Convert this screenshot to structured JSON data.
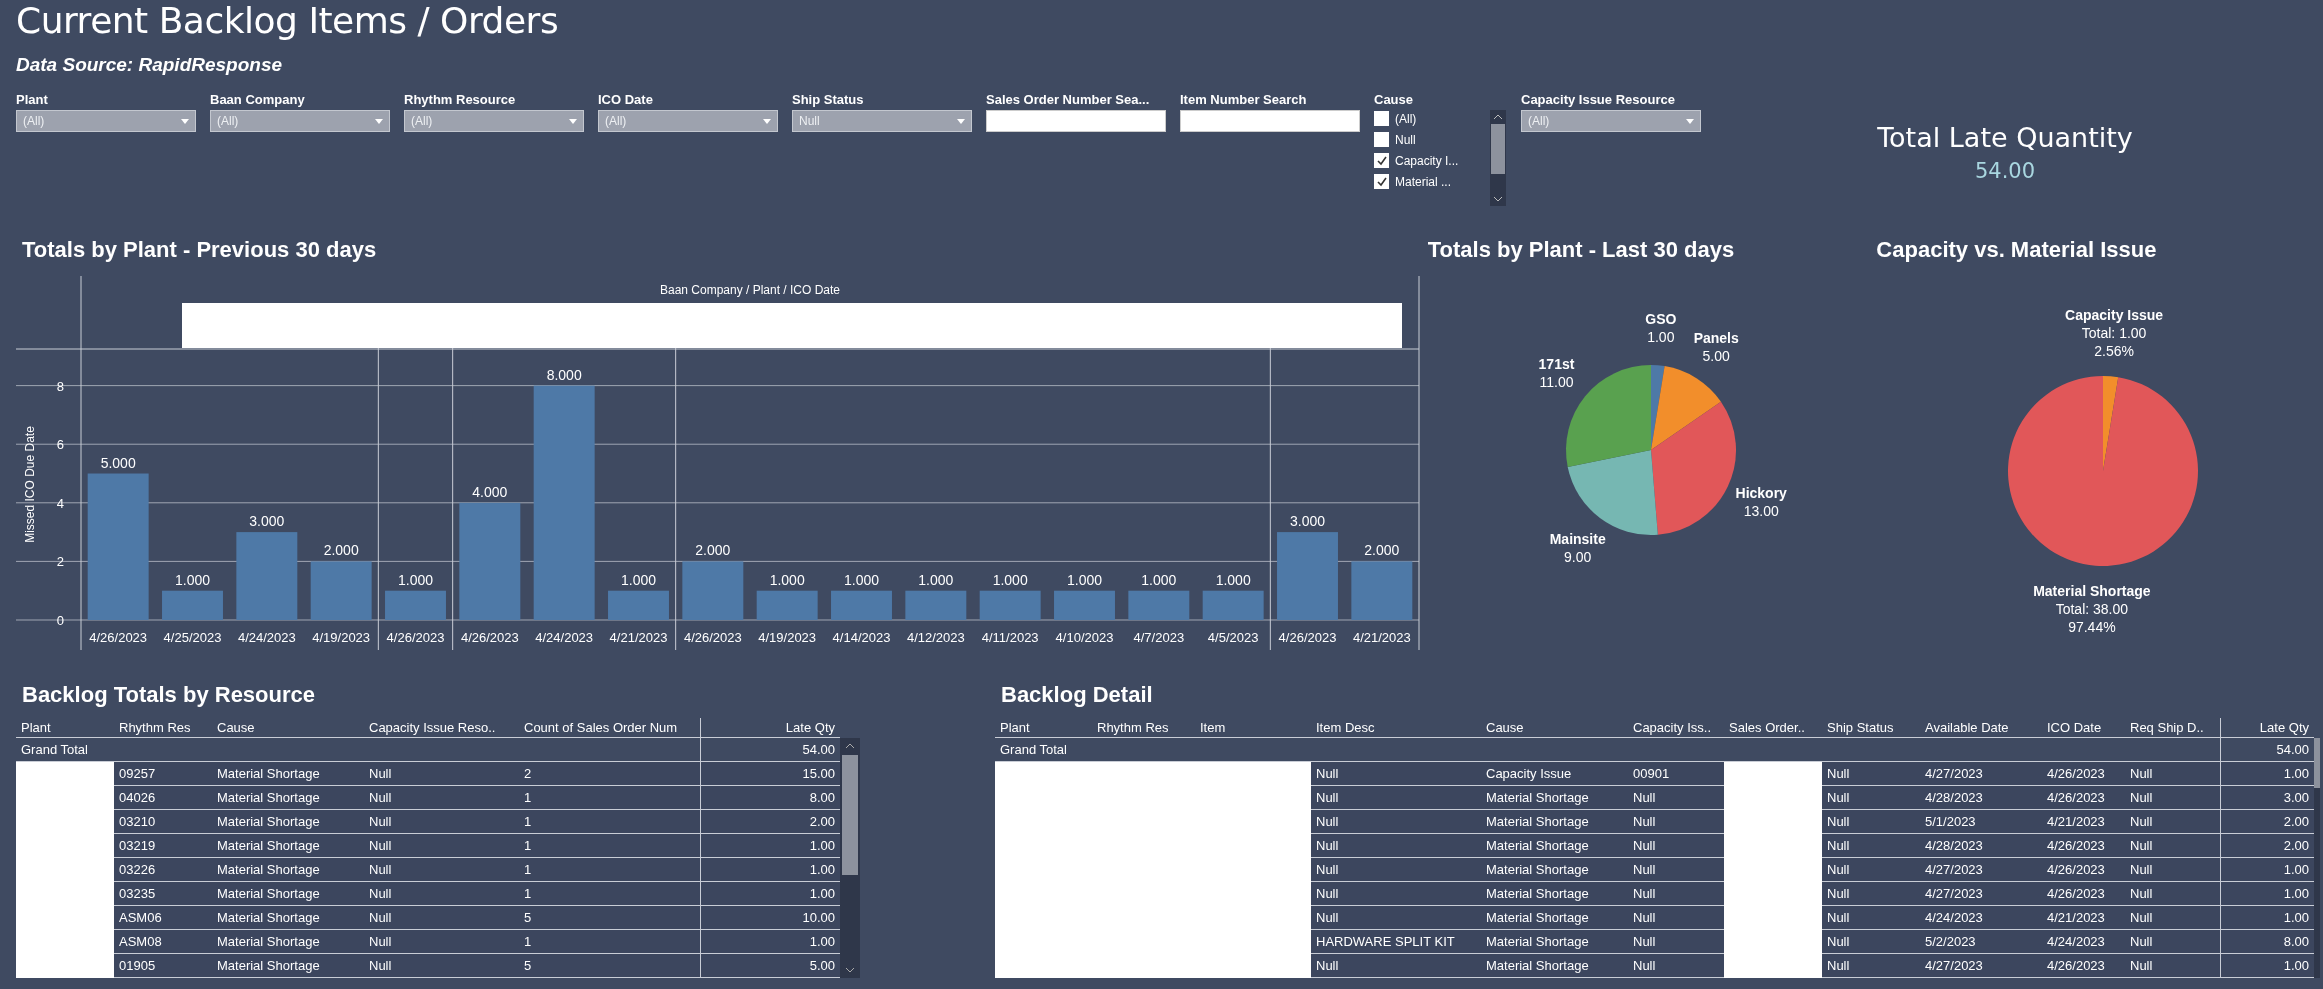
{
  "title": "Current Backlog Items / Orders",
  "subtitle": "Data Source: RapidResponse",
  "filters": [
    {
      "kind": "dropdown",
      "label": "Plant",
      "value": "(All)"
    },
    {
      "kind": "dropdown",
      "label": "Baan Company",
      "value": "(All)"
    },
    {
      "kind": "dropdown",
      "label": "Rhythm Resource",
      "value": "(All)"
    },
    {
      "kind": "dropdown",
      "label": "ICO Date",
      "value": "(All)"
    },
    {
      "kind": "dropdown",
      "label": "Ship Status",
      "value": "Null"
    },
    {
      "kind": "search",
      "label": "Sales Order Number Sea..."
    },
    {
      "kind": "search",
      "label": "Item Number Search"
    },
    {
      "kind": "checklist",
      "label": "Cause",
      "items": [
        {
          "label": "(All)",
          "checked": false
        },
        {
          "label": "Null",
          "checked": false
        },
        {
          "label": "Capacity I...",
          "checked": true
        },
        {
          "label": "Material ...",
          "checked": true
        }
      ]
    },
    {
      "kind": "dropdown",
      "label": "Capacity Issue Resource",
      "value": "(All)"
    }
  ],
  "total_late_quantity": {
    "label": "Total Late Quantity",
    "value": "54.00"
  },
  "bar_section": {
    "chart_data": {
      "type": "bar",
      "title": "Totals by Plant - Previous 30 days",
      "xlabel": "Baan Company / Plant / ICO Date",
      "categories": [
        "4/26/2023",
        "4/25/2023",
        "4/24/2023",
        "4/19/2023",
        "4/26/2023",
        "4/26/2023",
        "4/24/2023",
        "4/21/2023",
        "4/26/2023",
        "4/19/2023",
        "4/14/2023",
        "4/12/2023",
        "4/11/2023",
        "4/10/2023",
        "4/7/2023",
        "4/5/2023",
        "4/26/2023",
        "4/21/2023"
      ],
      "series": [
        {
          "name": "Missed ICO Due Date",
          "color": "#4e79a7",
          "values": [
            5,
            1,
            3,
            2,
            1,
            4,
            8,
            1,
            2,
            1,
            1,
            1,
            1,
            1,
            1,
            1,
            3,
            2
          ]
        }
      ],
      "ylim": [
        0,
        9.25
      ],
      "yticks": [
        0,
        2,
        4,
        6,
        8
      ],
      "grid": true,
      "value_labels": [
        "5.000",
        "1.000",
        "3.000",
        "2.000",
        "1.000",
        "4.000",
        "8.000",
        "1.000",
        "2.000",
        "1.000",
        "1.000",
        "1.000",
        "1.000",
        "1.000",
        "1.000",
        "1.000",
        "3.000",
        "2.000"
      ]
    }
  },
  "plant_pie": {
    "chart_data": {
      "type": "pie",
      "title": "Totals by Plant - Last 30 days",
      "categories": [
        "GSO",
        "Panels",
        "Hickory",
        "Mainsite",
        "171st"
      ],
      "values": [
        1,
        5,
        13,
        9,
        11
      ],
      "data_labels": true,
      "value_labels": [
        "1.00",
        "5.00",
        "13.00",
        "9.00",
        "11.00"
      ]
    },
    "slices": [
      {
        "color": "#4e79a7"
      },
      {
        "color": "#f28e2b"
      },
      {
        "color": "#e15759"
      },
      {
        "color": "#76b7b2"
      },
      {
        "color": "#59a14f"
      }
    ]
  },
  "cause_pie": {
    "chart_data": {
      "type": "pie",
      "title": "Capacity vs. Material Issue",
      "categories": [
        "Capacity Issue",
        "Material Shortage"
      ],
      "values": [
        1,
        38
      ],
      "data_labels": true,
      "value_labels": [
        "Total: 1.00",
        "Total: 38.00"
      ]
    },
    "slices": [
      {
        "color": "#f28e2b",
        "percent": "2.56%"
      },
      {
        "color": "#e15759",
        "percent": "97.44%"
      }
    ]
  },
  "resource_table": {
    "title": "Backlog Totals by Resource",
    "columns": [
      "Plant",
      "Rhythm Res",
      "Cause",
      "Capacity Issue Reso..",
      "Count of Sales Order Num",
      "Late Qty"
    ],
    "grand_total": {
      "label": "Grand Total",
      "late_qty": "54.00"
    },
    "rows": [
      [
        "",
        "09257",
        "Material Shortage",
        "Null",
        "2",
        "15.00"
      ],
      [
        "",
        "04026",
        "Material Shortage",
        "Null",
        "1",
        "8.00"
      ],
      [
        "",
        "03210",
        "Material Shortage",
        "Null",
        "1",
        "2.00"
      ],
      [
        "",
        "03219",
        "Material Shortage",
        "Null",
        "1",
        "1.00"
      ],
      [
        "",
        "03226",
        "Material Shortage",
        "Null",
        "1",
        "1.00"
      ],
      [
        "",
        "03235",
        "Material Shortage",
        "Null",
        "1",
        "1.00"
      ],
      [
        "",
        "ASM06",
        "Material Shortage",
        "Null",
        "5",
        "10.00"
      ],
      [
        "",
        "ASM08",
        "Material Shortage",
        "Null",
        "1",
        "1.00"
      ],
      [
        "",
        "01905",
        "Material Shortage",
        "Null",
        "5",
        "5.00"
      ]
    ]
  },
  "detail_table": {
    "title": "Backlog Detail",
    "columns": [
      "Plant",
      "Rhythm Res",
      "Item",
      "Item Desc",
      "Cause",
      "Capacity Iss..",
      "Sales Order..",
      "Ship Status",
      "Available Date",
      "ICO Date",
      "Req Ship D..",
      "Late Qty"
    ],
    "grand_total": {
      "label": "Grand Total",
      "late_qty": "54.00"
    },
    "rows": [
      [
        "",
        "",
        "",
        "Null",
        "Capacity Issue",
        "00901",
        "",
        "Null",
        "4/27/2023",
        "4/26/2023",
        "Null",
        "1.00"
      ],
      [
        "",
        "",
        "",
        "Null",
        "Material Shortage",
        "Null",
        "",
        "Null",
        "4/28/2023",
        "4/26/2023",
        "Null",
        "3.00"
      ],
      [
        "",
        "",
        "",
        "Null",
        "Material Shortage",
        "Null",
        "",
        "Null",
        "5/1/2023",
        "4/21/2023",
        "Null",
        "2.00"
      ],
      [
        "",
        "",
        "",
        "Null",
        "Material Shortage",
        "Null",
        "",
        "Null",
        "4/28/2023",
        "4/26/2023",
        "Null",
        "2.00"
      ],
      [
        "",
        "",
        "",
        "Null",
        "Material Shortage",
        "Null",
        "",
        "Null",
        "4/27/2023",
        "4/26/2023",
        "Null",
        "1.00"
      ],
      [
        "",
        "",
        "",
        "Null",
        "Material Shortage",
        "Null",
        "",
        "Null",
        "4/27/2023",
        "4/26/2023",
        "Null",
        "1.00"
      ],
      [
        "",
        "",
        "",
        "Null",
        "Material Shortage",
        "Null",
        "",
        "Null",
        "4/24/2023",
        "4/21/2023",
        "Null",
        "1.00"
      ],
      [
        "",
        "",
        "",
        "HARDWARE SPLIT KIT",
        "Material Shortage",
        "Null",
        "",
        "Null",
        "5/2/2023",
        "4/24/2023",
        "Null",
        "8.00"
      ],
      [
        "",
        "",
        "",
        "Null",
        "Material Shortage",
        "Null",
        "",
        "Null",
        "4/27/2023",
        "4/26/2023",
        "Null",
        "1.00"
      ]
    ]
  }
}
